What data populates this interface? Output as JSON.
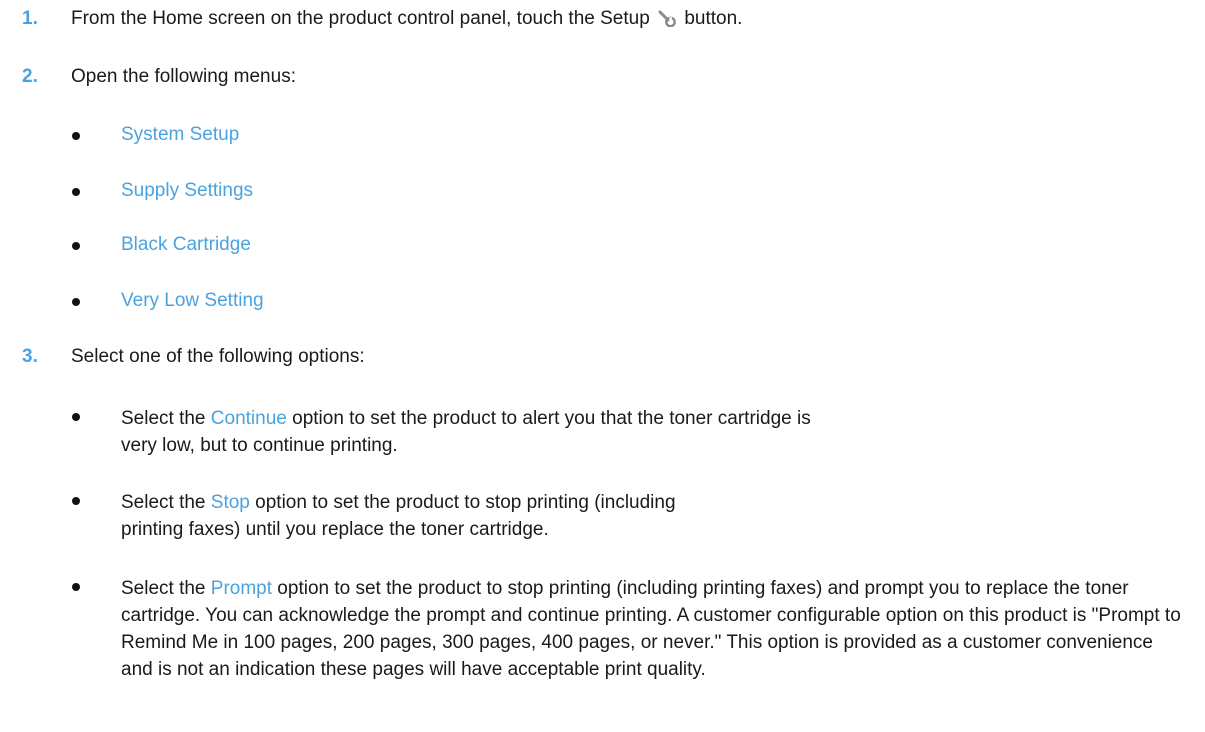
{
  "steps": [
    {
      "number": "1.",
      "text_before": "From the Home screen on the product control panel, touch the Setup",
      "icon": "wrench-icon",
      "text_after": "button."
    },
    {
      "number": "2.",
      "text": "Open the following menus:",
      "menus": [
        "System Setup",
        "Supply Settings",
        "Black Cartridge",
        "Very Low Setting"
      ]
    },
    {
      "number": "3.",
      "text": "Select one of the following options:",
      "options": [
        {
          "prefix": "Select the ",
          "keyword": "Continue",
          "suffix": " option to set the product to alert you that the toner cartridge is very low, but to continue printing."
        },
        {
          "prefix": "Select the ",
          "keyword": "Stop",
          "suffix": " option to set the product to stop printing (including printing faxes) until you replace the toner cartridge."
        },
        {
          "prefix": "Select the ",
          "keyword": "Prompt",
          "suffix": " option to set the product to stop printing (including printing faxes) and prompt you to replace the toner cartridge. You can acknowledge the prompt and continue printing. A customer configurable option on this product is \"Prompt to Remind Me in 100 pages, 200 pages, 300 pages, 400 pages, or never.\" This option is provided as a customer convenience and is not an indication these pages will have acceptable print quality."
        }
      ]
    }
  ],
  "colors": {
    "accent": "#4aa3df",
    "text": "#1a1a1a"
  }
}
